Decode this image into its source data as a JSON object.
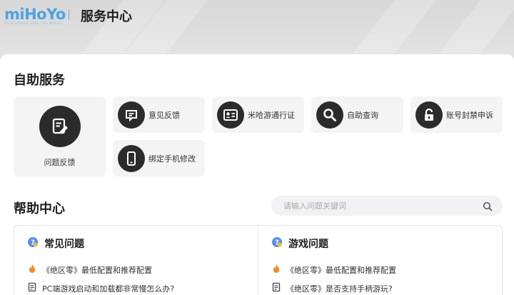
{
  "header": {
    "logo_text": "miHoYo",
    "logo_tagline": "TECH OTAKUS SAVE THE WORLD",
    "title": "服务中心"
  },
  "self_service": {
    "title": "自助服务",
    "items": [
      {
        "label": "问题反馈",
        "icon": "edit-document-icon"
      },
      {
        "label": "意见反馈",
        "icon": "feedback-message-icon"
      },
      {
        "label": "米哈游通行证",
        "icon": "id-card-icon"
      },
      {
        "label": "自助查询",
        "icon": "search-icon"
      },
      {
        "label": "账号封禁申诉",
        "icon": "unlock-icon"
      },
      {
        "label": "绑定手机修改",
        "icon": "phone-icon"
      }
    ]
  },
  "help_center": {
    "title": "帮助中心",
    "search_placeholder": "请输入问题关键词",
    "columns": [
      {
        "title": "常见问题",
        "items": [
          {
            "text": "《绝区零》最低配置和推荐配置",
            "icon": "fire-icon"
          },
          {
            "text": "PC端游戏启动和加载都非常慢怎么办?",
            "icon": "document-icon"
          }
        ]
      },
      {
        "title": "游戏问题",
        "items": [
          {
            "text": "《绝区零》最低配置和推荐配置",
            "icon": "fire-icon"
          },
          {
            "text": "《绝区零》是否支持手柄游玩?",
            "icon": "document-icon"
          }
        ]
      }
    ]
  },
  "colors": {
    "icon_circle": "#2b2b2b",
    "tile_bg": "#f4f4f4",
    "logo_blue": "#4da3e6",
    "fire_orange": "#f5892c",
    "question_badge_blue": "#5b8def"
  }
}
